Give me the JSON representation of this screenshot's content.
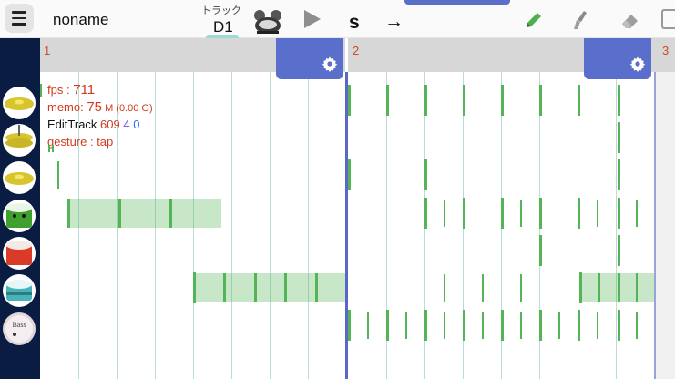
{
  "toolbar": {
    "song_title": "noname",
    "track_caption": "トラック",
    "track_name": "D1",
    "s_mark": "s",
    "arrow": "→"
  },
  "measures": [
    {
      "number": "1"
    },
    {
      "number": "2"
    },
    {
      "number": "3"
    }
  ],
  "debug": {
    "fps_label": "fps : ",
    "fps_value": "711",
    "memo_label": "memo: ",
    "memo_value": "75",
    "memo_unit": " M (0.00 G)",
    "edit_label": "EditTrack",
    "edit_a": "609",
    "edit_b": "4",
    "edit_c": "0",
    "gesture": "gesture : tap"
  },
  "instruments": [
    {
      "name": "cymbal-1",
      "color": "#e3d23a"
    },
    {
      "name": "hihat",
      "color": "#e3d23a"
    },
    {
      "name": "cymbal-2",
      "color": "#e3d23a"
    },
    {
      "name": "tom-high",
      "color": "#3fa02f"
    },
    {
      "name": "tom-low",
      "color": "#d93b28"
    },
    {
      "name": "snare",
      "color": "#48b4ba"
    },
    {
      "name": "bass",
      "color": "#e0d6da",
      "label": "Bass"
    }
  ],
  "colors": {
    "note": "#53b557",
    "barline": "#5a67c6",
    "settings": "#5a6fcc",
    "sidebar": "#0b1c42"
  }
}
